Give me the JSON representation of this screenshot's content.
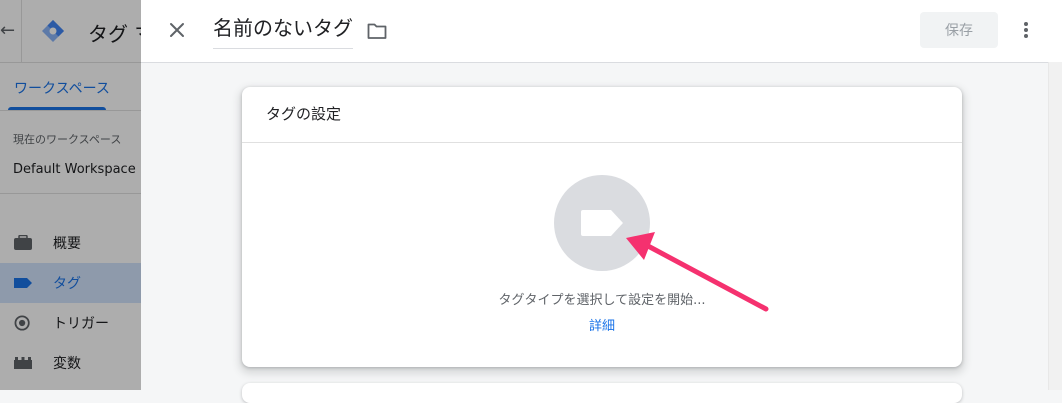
{
  "background_app": {
    "title": "タグ マ",
    "workspace_tab": "ワークスペース",
    "current_workspace_label": "現在のワークスペース",
    "workspace_name": "Default Workspace",
    "nav": [
      {
        "label": "概要",
        "icon": "briefcase-icon",
        "active": false
      },
      {
        "label": "タグ",
        "icon": "tag-icon",
        "active": true
      },
      {
        "label": "トリガー",
        "icon": "trigger-icon",
        "active": false
      },
      {
        "label": "変数",
        "icon": "variable-icon",
        "active": false
      }
    ]
  },
  "editor": {
    "tag_name": "名前のないタグ",
    "save_label": "保存",
    "card": {
      "title": "タグの設定",
      "hint": "タグタイプを選択して設定を開始...",
      "link": "詳細"
    }
  },
  "colors": {
    "accent": "#1a73e8",
    "annotation_arrow": "#f5316f",
    "logo_light": "#8ab4f8",
    "logo_dark": "#4285f4"
  }
}
